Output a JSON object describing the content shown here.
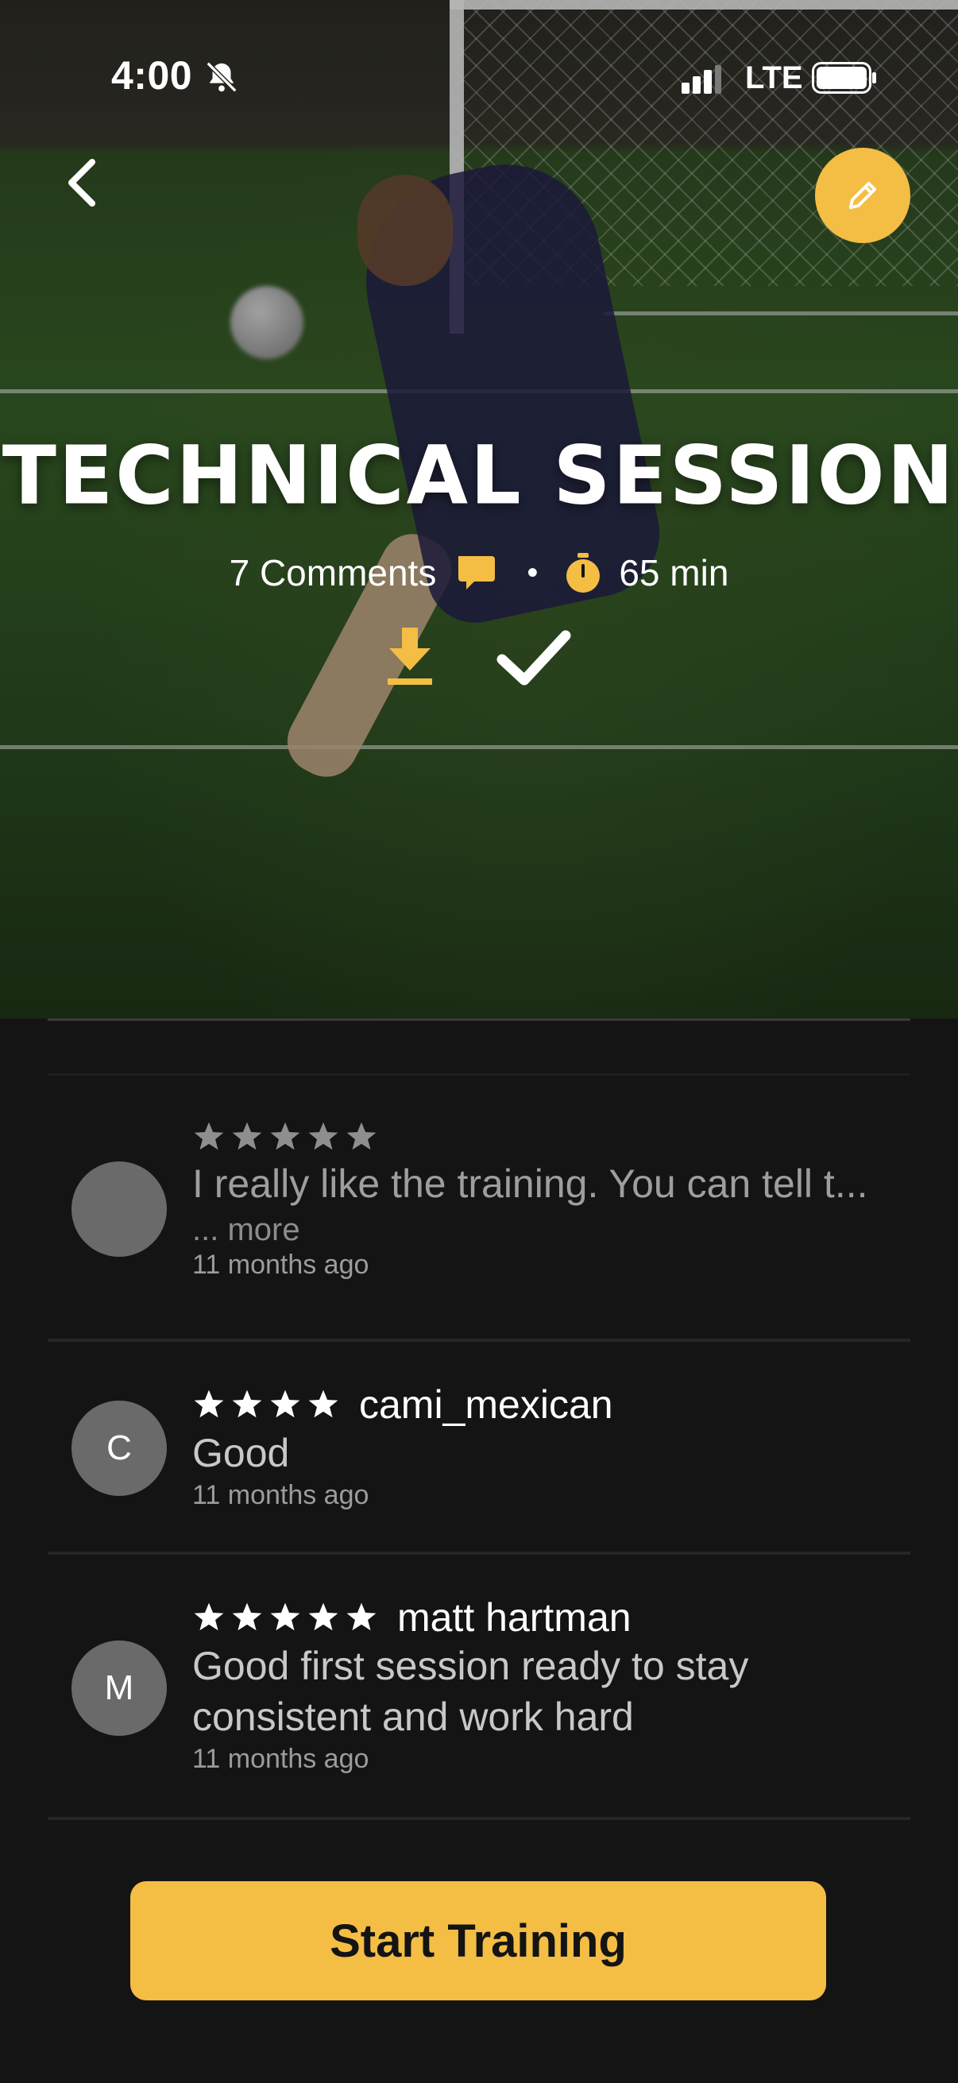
{
  "status_bar": {
    "time": "4:00",
    "network": "LTE"
  },
  "session": {
    "title": "TECHNICAL SESSION",
    "comments": "7 Comments",
    "separator": "•",
    "duration": "65 min"
  },
  "reviews": [
    {
      "stars": 5,
      "username": "",
      "initial": "",
      "text": "I really like the training. You can tell t...",
      "more": "... more",
      "time": "11 months ago"
    },
    {
      "stars": 4,
      "username": "cami_mexican",
      "initial": "C",
      "text": "Good",
      "time": "11 months ago"
    },
    {
      "stars": 5,
      "username": "matt hartman",
      "initial": "M",
      "text_lines": [
        "Good first session ready to stay",
        "consistent and work hard"
      ],
      "time": "11 months ago"
    }
  ],
  "start_button": "Start Training",
  "colors": {
    "accent": "#f4bd44",
    "background": "#141414",
    "star_dim": "#8e8e8e",
    "star_bright": "#ffffff"
  },
  "icons": [
    "bell-slash-icon",
    "signal-icon",
    "battery-icon",
    "back-chevron-icon",
    "pencil-icon",
    "comment-icon",
    "stopwatch-icon",
    "download-icon",
    "checkmark-icon",
    "star-icon"
  ]
}
